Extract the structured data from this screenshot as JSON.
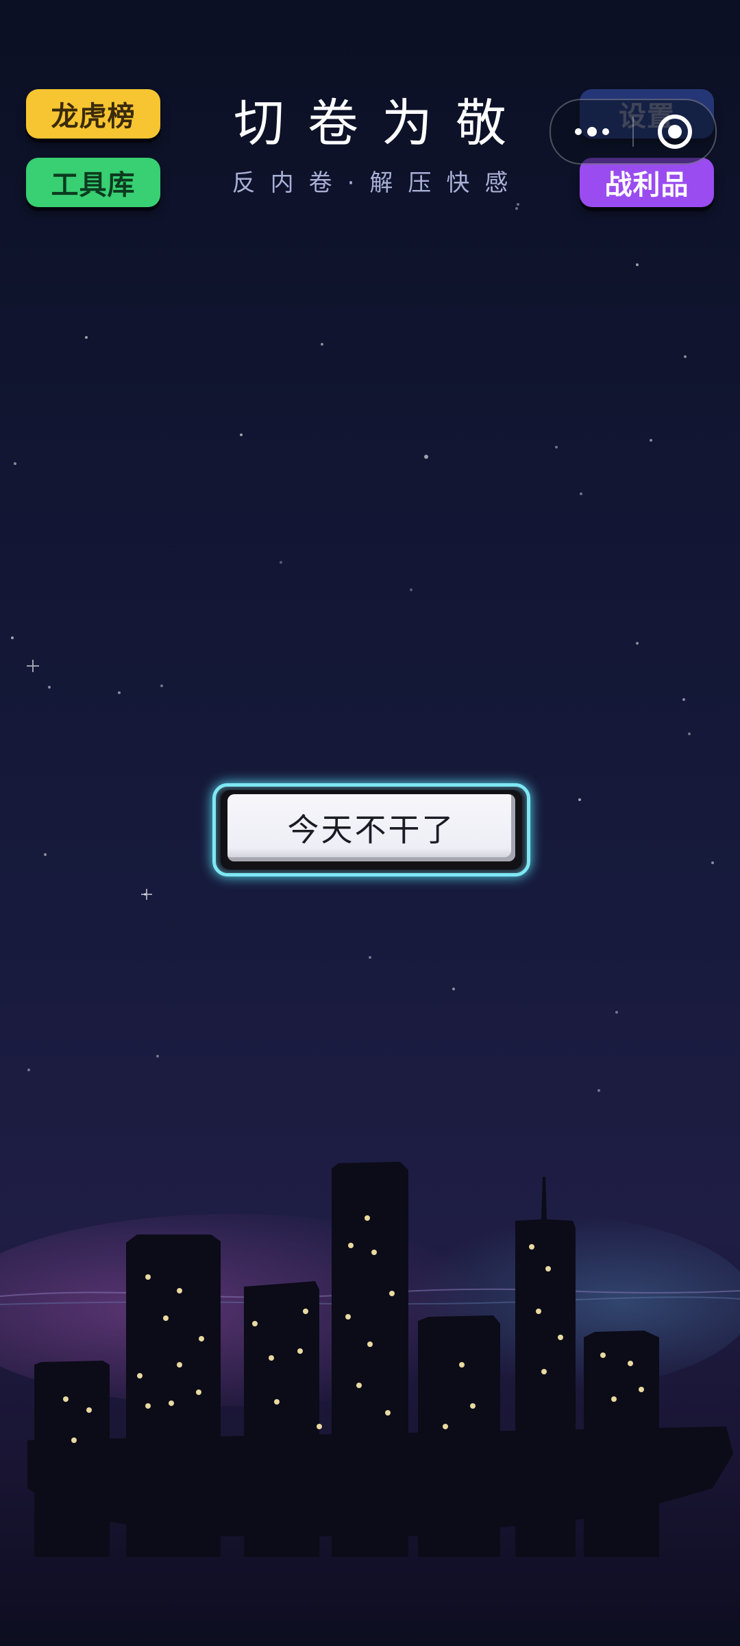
{
  "title": "切卷为敬",
  "subtitle": "反内卷·解压快感",
  "top_left_buttons": {
    "leaderboard": "龙虎榜",
    "toolbox": "工具库"
  },
  "top_right_buttons": {
    "settings": "设置",
    "loot": "战利品"
  },
  "capsule": {
    "more_icon": "more-dots-icon",
    "close_icon": "target-close-icon"
  },
  "main_button": {
    "label": "今天不干了"
  },
  "colors": {
    "yellow": "#f7c531",
    "green": "#38d072",
    "blue": "#3a55b8",
    "purple": "#9a4cf0",
    "glow": "#7fe7f4"
  }
}
